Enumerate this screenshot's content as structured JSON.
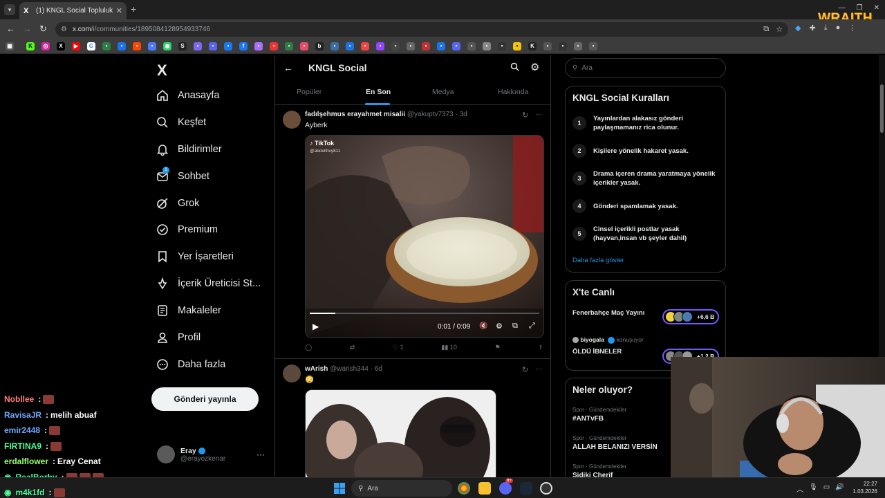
{
  "browser": {
    "tab_title": "(1) KNGL Social Topluluk / X",
    "tab_favicon": "X",
    "url_main": "x.com",
    "url_path": "/i/communities/1895084128954933746",
    "new_tab": "+",
    "overlay_brand": "WRAITH"
  },
  "nav": {
    "logo": "X",
    "items": [
      {
        "label": "Anasayfa",
        "icon": "home-icon"
      },
      {
        "label": "Keşfet",
        "icon": "search-icon"
      },
      {
        "label": "Bildirimler",
        "icon": "bell-icon"
      },
      {
        "label": "Sohbet",
        "icon": "mail-icon",
        "badge": "1"
      },
      {
        "label": "Grok",
        "icon": "grok-icon"
      },
      {
        "label": "Premium",
        "icon": "premium-icon"
      },
      {
        "label": "Yer İşaretleri",
        "icon": "bookmark-icon"
      },
      {
        "label": "İçerik Üreticisi St...",
        "icon": "creator-icon"
      },
      {
        "label": "Makaleler",
        "icon": "articles-icon"
      },
      {
        "label": "Profil",
        "icon": "profile-icon"
      },
      {
        "label": "Daha fazla",
        "icon": "more-icon"
      }
    ],
    "post_button": "Gönderi yayınla",
    "profile_name": "Eray",
    "profile_handle": "@erayozkenar",
    "profile_more": "···"
  },
  "community": {
    "title": "KNGL Social",
    "tabs": [
      "Popüler",
      "En Son",
      "Medya",
      "Hakkında"
    ],
    "active_tab": "En Son"
  },
  "tweets": [
    {
      "name": "fadılşehmus erayahmet misalii",
      "handle": "@yakuptv7373",
      "time": "3d",
      "text": "Ayberk",
      "video_brand": "TikTok",
      "video_user": "@abdullhvy811",
      "video_time": "0:01 / 0:09",
      "video_progress": 0.11,
      "replies": "",
      "retweets": "",
      "likes": "1",
      "views": "10"
    },
    {
      "name": "wArish",
      "handle": "@warish344",
      "time": "6d",
      "text": "😳"
    }
  ],
  "right": {
    "search_placeholder": "Ara",
    "rules_title": "KNGL Social Kuralları",
    "rules": [
      {
        "num": "1",
        "text": "Yayınlardan alakasız gönderi paylaşmamanız rica olunur."
      },
      {
        "num": "2",
        "text": "Kişilere yönelik hakaret yasak."
      },
      {
        "num": "3",
        "text": "Drama içeren drama yaratmaya yönelik içerikler yasak."
      },
      {
        "num": "4",
        "text": "Gönderi spamlamak yasak."
      },
      {
        "num": "5",
        "text": "Cinsel içerikli postlar yasak (hayvan,insan vb şeyler dahil)"
      }
    ],
    "show_more": "Daha fazla göster",
    "live_title": "X'te Canlı",
    "live": [
      {
        "title": "Fenerbahçe Maç Yayını",
        "count": "+6,6 B"
      },
      {
        "host": "biyogala",
        "status": "konuşuyor",
        "title": "ÖLDÜ İBNELER",
        "count": "+1,2 B"
      }
    ],
    "trends_title": "Neler oluyor?",
    "trends": [
      {
        "meta": "Spor · Gündemdekiler",
        "name": "#ANTvFB"
      },
      {
        "meta": "Spor · Gündemdekiler",
        "name": "ALLAH BELANIZI VERSİN"
      },
      {
        "meta": "Spor · Gündemdekiler",
        "name": "Sidiki Cherif"
      }
    ]
  },
  "chat": [
    {
      "user": "Nobllee",
      "color": "#ff7f7f",
      "msg": "",
      "emotes": 1
    },
    {
      "user": "RavisaJR",
      "color": "#6fa8ff",
      "msg": "melih abuaf",
      "emotes": 0
    },
    {
      "user": "emir2448",
      "color": "#6fa8ff",
      "msg": "",
      "emotes": 1
    },
    {
      "user": "FIRTINA9",
      "color": "#4cff9a",
      "msg": "",
      "emotes": 1
    },
    {
      "user": "erdalflower",
      "color": "#9cff6a",
      "msg": "Eray Cenat",
      "emotes": 0
    },
    {
      "user": "RealBorby",
      "color": "#4cff9a",
      "msg": ",",
      "emotes": 3
    },
    {
      "user": "m4k1fd",
      "color": "#4cff9a",
      "msg": "",
      "emotes": 1
    }
  ],
  "taskbar": {
    "search_placeholder": "Ara",
    "time": "22:27",
    "date": "1.03.2026",
    "discord_badge": "9+"
  },
  "colors": {
    "accent": "#1d9bf0",
    "background": "#000000",
    "border": "#2f3336",
    "live_purple": "#7856ff"
  }
}
